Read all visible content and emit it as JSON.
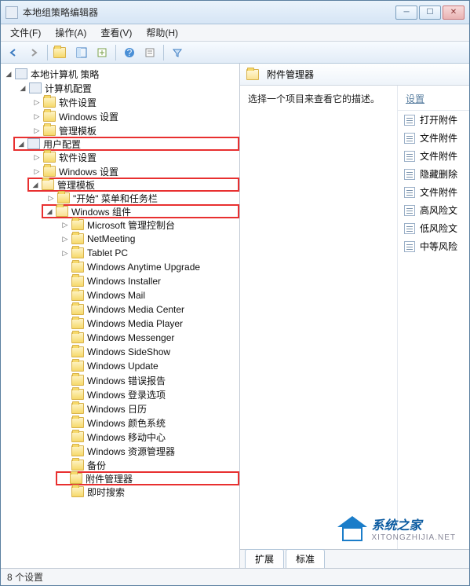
{
  "window": {
    "title": "本地组策略编辑器"
  },
  "menu": {
    "file": "文件(F)",
    "action": "操作(A)",
    "view": "查看(V)",
    "help": "帮助(H)"
  },
  "tree": {
    "root": "本地计算机 策略",
    "computer": "计算机配置",
    "c_items": [
      "软件设置",
      "Windows 设置",
      "管理模板"
    ],
    "user": "用户配置",
    "u_software": "软件设置",
    "u_windows": "Windows 设置",
    "u_admin": "管理模板",
    "start_menu": "\"开始\" 菜单和任务栏",
    "win_components": "Windows 组件",
    "components": [
      "Microsoft 管理控制台",
      "NetMeeting",
      "Tablet PC",
      "Windows Anytime Upgrade",
      "Windows Installer",
      "Windows Mail",
      "Windows Media Center",
      "Windows Media Player",
      "Windows Messenger",
      "Windows SideShow",
      "Windows Update",
      "Windows 错误报告",
      "Windows 登录选项",
      "Windows 日历",
      "Windows 颜色系统",
      "Windows 移动中心",
      "Windows 资源管理器",
      "备份",
      "附件管理器",
      "即时搜索"
    ]
  },
  "right": {
    "header": "附件管理器",
    "desc": "选择一个项目来查看它的描述。",
    "settings_label": "设置",
    "settings": [
      "打开附件",
      "文件附件",
      "文件附件",
      "隐藏删除",
      "文件附件",
      "高风险文",
      "低风险文",
      "中等风险"
    ]
  },
  "tabs": {
    "extended": "扩展",
    "standard": "标准"
  },
  "status": "8 个设置",
  "watermark": {
    "brand": "系统之家",
    "url": "XITONGZHIJIA.NET"
  }
}
